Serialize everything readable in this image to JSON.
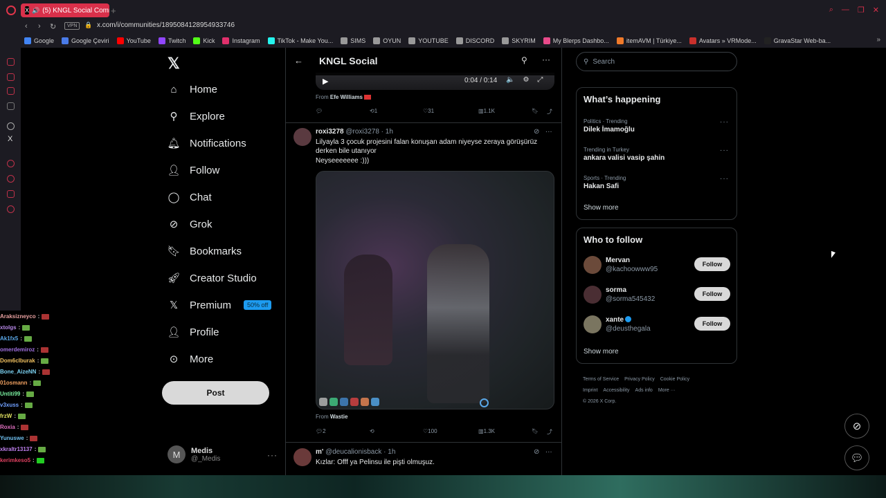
{
  "browser": {
    "tab_title": "(5) KNGL Social Comm",
    "url": "x.com/i/communities/1895084128954933746",
    "vpn": "VPN",
    "bookmarks": [
      {
        "label": "Google",
        "color": "#4285f4"
      },
      {
        "label": "Google Çeviri",
        "color": "#4a7be8"
      },
      {
        "label": "YouTube",
        "color": "#ff0000"
      },
      {
        "label": "Twitch",
        "color": "#9146ff"
      },
      {
        "label": "Kick",
        "color": "#53fc18"
      },
      {
        "label": "Instagram",
        "color": "#e1306c"
      },
      {
        "label": "TikTok - Make You...",
        "color": "#25f4ee"
      },
      {
        "label": "SIMS",
        "color": "#999"
      },
      {
        "label": "OYUN",
        "color": "#999"
      },
      {
        "label": "YOUTUBE",
        "color": "#999"
      },
      {
        "label": "DISCORD",
        "color": "#999"
      },
      {
        "label": "SKYRIM",
        "color": "#999"
      },
      {
        "label": "My Blerps Dashbo...",
        "color": "#e84a8a"
      },
      {
        "label": "itemAVM | Türkiye...",
        "color": "#f07a2a"
      },
      {
        "label": "Avatars » VRMode...",
        "color": "#c9302c"
      },
      {
        "label": "GravaStar Web-ba...",
        "color": "#222"
      }
    ]
  },
  "nav": {
    "items": [
      {
        "label": "Home",
        "icon": "home-icon"
      },
      {
        "label": "Explore",
        "icon": "search-icon"
      },
      {
        "label": "Notifications",
        "icon": "bell-icon"
      },
      {
        "label": "Follow",
        "icon": "person-add-icon"
      },
      {
        "label": "Chat",
        "icon": "chat-icon"
      },
      {
        "label": "Grok",
        "icon": "grok-icon"
      },
      {
        "label": "Bookmarks",
        "icon": "bookmark-icon"
      },
      {
        "label": "Creator Studio",
        "icon": "rocket-icon"
      },
      {
        "label": "Premium",
        "icon": "x-icon"
      },
      {
        "label": "Profile",
        "icon": "person-icon"
      },
      {
        "label": "More",
        "icon": "more-circle-icon"
      }
    ],
    "premium_badge": "50% off",
    "post_button": "Post",
    "account": {
      "initial": "M",
      "name": "Medis",
      "handle": "@_Medis"
    }
  },
  "feed": {
    "title": "KNGL Social",
    "video": {
      "time": "0:04 / 0:14"
    },
    "post1": {
      "from_prefix": "From",
      "from_name": "Efe Williams",
      "replies": "",
      "reposts": "1",
      "likes": "31",
      "views": "1.1K"
    },
    "post2": {
      "name": "roxi3278",
      "handle": "@roxi3278",
      "time": "· 1h",
      "text": "Lilyayla 3 çocuk projesini falan konuşan adam niyeyse zeraya görüşürüz derken bile utanıyor",
      "text2": "Neyseeeeeee :)))",
      "from_prefix": "From",
      "from_name": "Wastie",
      "replies": "2",
      "reposts": "",
      "likes": "100",
      "views": "1.3K"
    },
    "post3": {
      "name": "m'",
      "handle": "@deucalionisback",
      "time": "· 1h",
      "text": "Kızlar: Offf ya Pelinsu ile pişti olmuşuz."
    }
  },
  "right": {
    "search_placeholder": "Search",
    "happening_title": "What’s happening",
    "trends": [
      {
        "context": "Politics · Trending",
        "name": "Dilek İmamoğlu"
      },
      {
        "context": "Trending in Turkey",
        "name": "ankara valisi vasip şahin"
      },
      {
        "context": "Sports · Trending",
        "name": "Hakan Safi"
      }
    ],
    "show_more": "Show more",
    "wtf_title": "Who to follow",
    "follow_label": "Follow",
    "suggestions": [
      {
        "name": "Mervan",
        "handle": "@kachoowww95",
        "color": "#6b4a3a"
      },
      {
        "name": "sorma",
        "handle": "@sorma545432",
        "color": "#4a2e33"
      },
      {
        "name": "xante",
        "handle": "@deusthegala",
        "color": "#7a7560"
      }
    ],
    "footer": [
      "Terms of Service",
      "Privacy Policy",
      "Cookie Policy",
      "Imprint",
      "Accessibility",
      "Ads info",
      "More ···",
      "© 2026 X Corp."
    ]
  },
  "chat": [
    {
      "user": "Araksizneyco",
      "color": "#e8a0a0",
      "badge": "#a33"
    },
    {
      "user": "xtolgs",
      "color": "#b889e8",
      "badge": "#6a4"
    },
    {
      "user": "Ak1fx5",
      "color": "#5aa8e8",
      "badge": "#6a4"
    },
    {
      "user": "omerdemiroz",
      "color": "#a070e0",
      "badge": "#a33"
    },
    {
      "user": "Dom6cIburak",
      "color": "#f0c060",
      "badge": "#6a4"
    },
    {
      "user": "Bone_AizeNN",
      "color": "#7ad0f0",
      "badge": "#a33"
    },
    {
      "user": "01osmann",
      "color": "#f0a060",
      "badge": "#6a4"
    },
    {
      "user": "Untiti99",
      "color": "#7af0a0",
      "badge": "#6a4"
    },
    {
      "user": "v3xuss",
      "color": "#70a0ff",
      "badge": "#6a4"
    },
    {
      "user": "frzW",
      "color": "#e0e060",
      "badge": "#6a4"
    },
    {
      "user": "Roxia",
      "color": "#e070c0",
      "badge": "#a33"
    },
    {
      "user": "Yunuswe",
      "color": "#70c0f0",
      "badge": "#a33"
    },
    {
      "user": "xkraltr13137",
      "color": "#c080f0",
      "badge": "#6a4"
    },
    {
      "user": "kerimkeso5",
      "color": "#e04060",
      "badge": "#2c2"
    }
  ]
}
